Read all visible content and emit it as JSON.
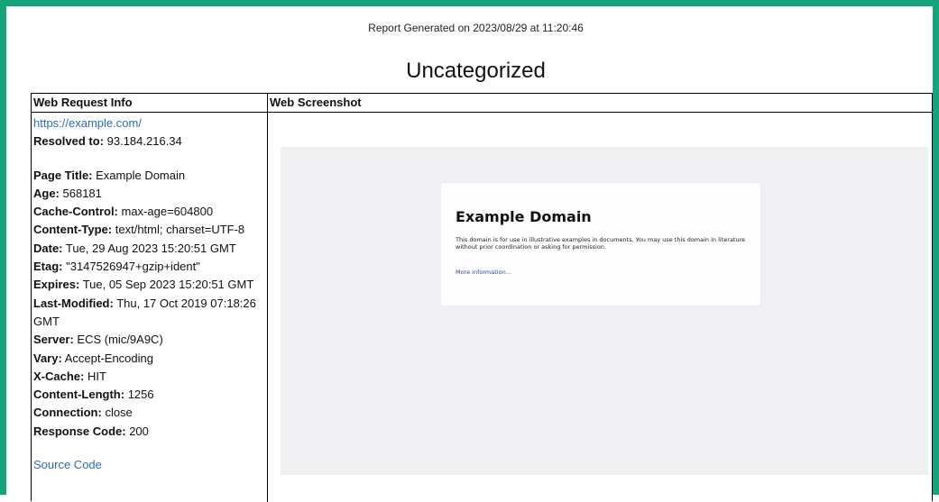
{
  "report": {
    "generated": "Report Generated on 2023/08/29 at 11:20:46",
    "category": "Uncategorized"
  },
  "table": {
    "headers": {
      "info": "Web Request Info",
      "screenshot": "Web Screenshot"
    },
    "url": "https://example.com/",
    "resolved": {
      "key": "Resolved to:",
      "value": " 93.184.216.34"
    },
    "headers_list": [
      {
        "key": "Page Title:",
        "value": " Example Domain"
      },
      {
        "key": "Age:",
        "value": " 568181"
      },
      {
        "key": "Cache-Control:",
        "value": " max-age=604800"
      },
      {
        "key": "Content-Type:",
        "value": " text/html; charset=UTF-8"
      },
      {
        "key": "Date:",
        "value": " Tue, 29 Aug 2023 15:20:51 GMT"
      },
      {
        "key": "Etag:",
        "value": " \"3147526947+gzip+ident\""
      },
      {
        "key": "Expires:",
        "value": " Tue, 05 Sep 2023 15:20:51 GMT"
      },
      {
        "key": "Last-Modified:",
        "value": " Thu, 17 Oct 2019 07:18:26 GMT"
      },
      {
        "key": "Server:",
        "value": " ECS (mic/9A9C)"
      },
      {
        "key": "Vary:",
        "value": " Accept-Encoding"
      },
      {
        "key": "X-Cache:",
        "value": " HIT"
      },
      {
        "key": "Content-Length:",
        "value": " 1256"
      },
      {
        "key": "Connection:",
        "value": " close"
      },
      {
        "key": "Response Code:",
        "value": " 200"
      }
    ],
    "source_link": "Source Code"
  },
  "screenshot": {
    "title": "Example Domain",
    "body": "This domain is for use in illustrative examples in documents. You may use this domain in literature without prior coordination or asking for permission.",
    "link": "More information..."
  },
  "colors": {
    "frame": "#15a37b",
    "link": "#2a6ebb"
  }
}
